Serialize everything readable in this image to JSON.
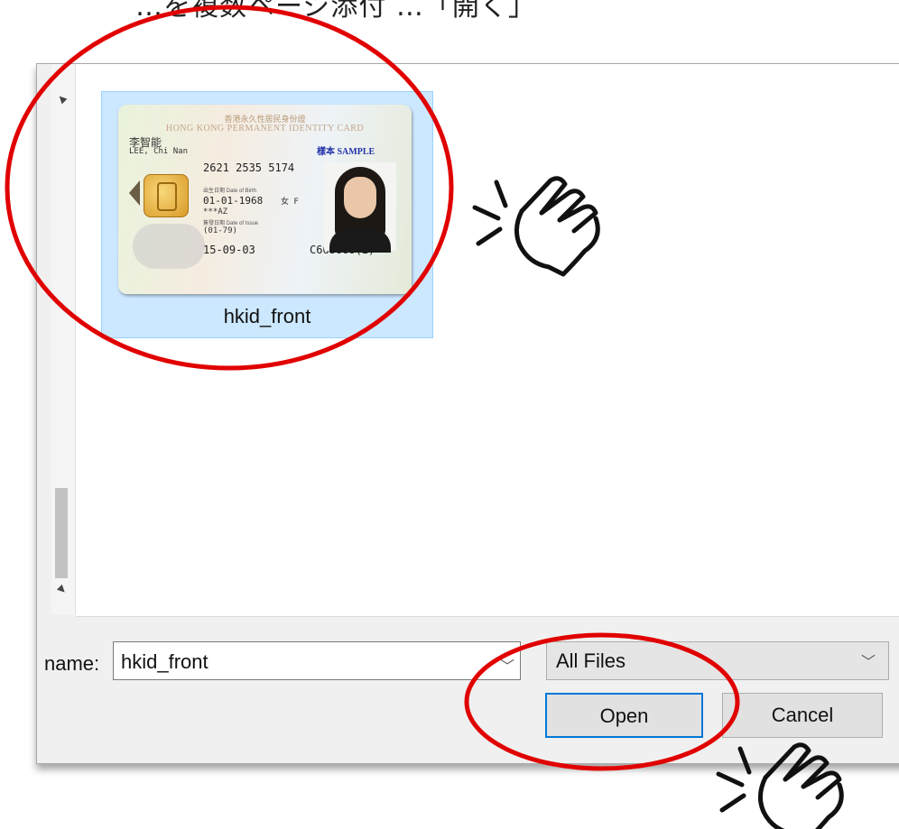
{
  "caption": "…を複数ページ添付 …「開く」",
  "dialog": {
    "file": {
      "name": "hkid_front",
      "card": {
        "title_zh": "香港永久性居民身份證",
        "title_en": "HONG KONG PERMANENT IDENTITY CARD",
        "name_zh": "李智能",
        "name_en": "LEE, Chi Nan",
        "sample": "樣本 SAMPLE",
        "code": "2621 2535 5174",
        "dob_label": "出生日期 Date of Birth",
        "dob": "01-01-1968",
        "sex": "女 F",
        "symbols": "***AZ",
        "issue_label": "簽發日期 Date of Issue",
        "first_registration": "(01-79)",
        "issue_date": "15-09-03",
        "id_number": "C668668(E)"
      }
    },
    "filename_label": "name:",
    "filename_value": "hkid_front",
    "filetype": "All Files",
    "open_label": "Open",
    "cancel_label": "Cancel"
  },
  "colors": {
    "selection_bg": "#cce8ff",
    "annotation_red": "#e10000",
    "open_focus_border": "#0078d7"
  },
  "icons": [
    "chevron-down-icon",
    "pointing-hand-icon",
    "scroll-arrow-icon"
  ]
}
